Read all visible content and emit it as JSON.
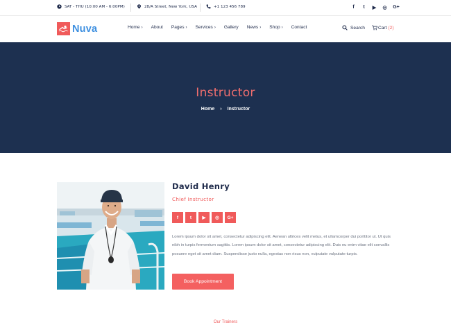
{
  "topbar": {
    "hours": "SAT - THU (10:00 AM - 6:00PM)",
    "address": "28/A Street, New York, USA",
    "phone": "+1 123 456 789",
    "social_icons": [
      "facebook-icon",
      "twitter-icon",
      "youtube-icon",
      "instagram-icon",
      "google-plus-icon"
    ],
    "social_glyphs": [
      "f",
      "t",
      "▶",
      "◎",
      "G+"
    ]
  },
  "header": {
    "logo_text": "Nuva",
    "nav": [
      {
        "label": "Home",
        "dropdown": true
      },
      {
        "label": "About",
        "dropdown": false
      },
      {
        "label": "Pages",
        "dropdown": true
      },
      {
        "label": "Services",
        "dropdown": true
      },
      {
        "label": "Gallery",
        "dropdown": false
      },
      {
        "label": "News",
        "dropdown": true
      },
      {
        "label": "Shop",
        "dropdown": true
      },
      {
        "label": "Contact",
        "dropdown": false
      }
    ],
    "search_label": "Search",
    "cart_label": "Cart",
    "cart_count": "(2)"
  },
  "hero": {
    "title": "Instructor",
    "breadcrumb": [
      "Home",
      "Instructor"
    ]
  },
  "profile": {
    "name": "David Henry",
    "role": "Chief Instructor",
    "social_icons": [
      "facebook-icon",
      "twitter-icon",
      "youtube-icon",
      "instagram-icon",
      "google-plus-icon"
    ],
    "social_glyphs": [
      "f",
      "t",
      "▶",
      "◎",
      "G+"
    ],
    "bio": "Lorem ipsum dolor sit amet, consectetur adipiscing elit. Aenean ultrices velit metus, et ullamcorper dui porttitor ut. Ut quis nibh in turpis fermentum sagittis. Lorem ipsum dolor sit amet, consectetur adipiscing elit. Duis eu enim vitae elit convallis posuere eget sit amet diam. Suspendisse justo nulla, egestas non risus non, vulputate vulputate turpis.",
    "button_label": "Book Appointment"
  },
  "section": {
    "trainers_label": "Our Trainers"
  },
  "colors": {
    "accent": "#f05a5a",
    "navy": "#1d3050",
    "logo_blue": "#3d8fe0"
  }
}
